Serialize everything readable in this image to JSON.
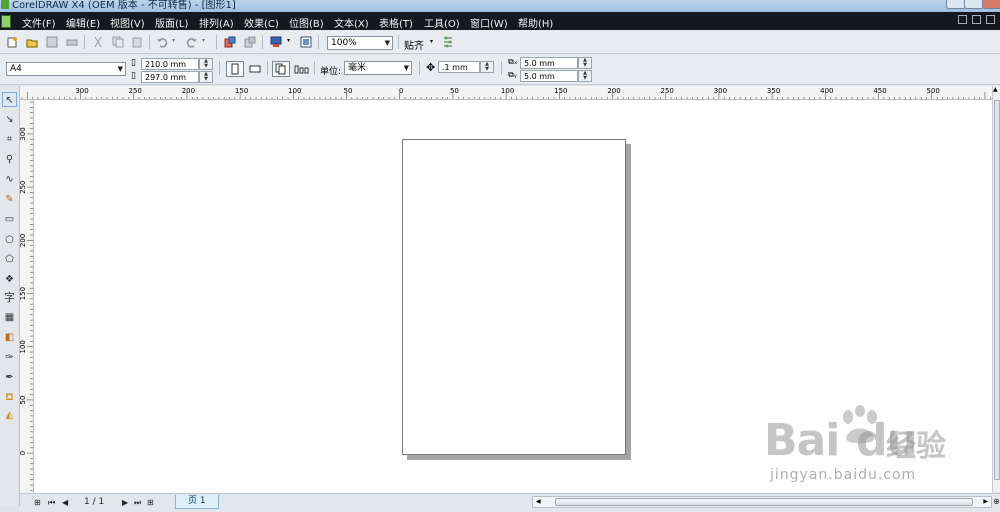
{
  "window": {
    "title": "CorelDRAW X4 (OEM 版本 - 不可转售) - [图形1]"
  },
  "menu": [
    "文件(F)",
    "编辑(E)",
    "视图(V)",
    "版面(L)",
    "排列(A)",
    "效果(C)",
    "位图(B)",
    "文本(X)",
    "表格(T)",
    "工具(O)",
    "窗口(W)",
    "帮助(H)"
  ],
  "toolbar": {
    "zoom": "100%",
    "snap_label": "贴齐"
  },
  "propbar": {
    "paper": "A4",
    "width": "210.0 mm",
    "height": "297.0 mm",
    "unit_label": "单位:",
    "unit_value": "毫米",
    "nudge": ".1 mm",
    "dup_x": "5.0 mm",
    "dup_y": "5.0 mm"
  },
  "ruler": {
    "h_ticks": [
      "300",
      "250",
      "200",
      "150",
      "100",
      "50",
      "0",
      "50",
      "100",
      "150",
      "200",
      "250",
      "300",
      "350",
      "400",
      "450",
      "500"
    ],
    "v_ticks": [
      "300",
      "250",
      "200",
      "150",
      "100",
      "50",
      "0"
    ]
  },
  "toolbox_tools": [
    "pick-tool",
    "shape-tool",
    "crop-tool",
    "zoom-tool",
    "freehand-tool",
    "smart-fill-tool",
    "rectangle-tool",
    "ellipse-tool",
    "polygon-tool",
    "basic-shapes-tool",
    "text-tool",
    "table-tool",
    "interactive-tool",
    "eyedropper-tool",
    "outline-tool",
    "fill-tool",
    "interactive-fill-tool"
  ],
  "toolbox": {
    "text_tool_glyph": "字"
  },
  "statusbar": {
    "page_counter": "1 / 1",
    "page_tab": "页 1"
  },
  "watermark": {
    "brand": "Bai",
    "brand_tail": "du",
    "brand_cn": "经验",
    "url": "jingyan.baidu.com"
  }
}
